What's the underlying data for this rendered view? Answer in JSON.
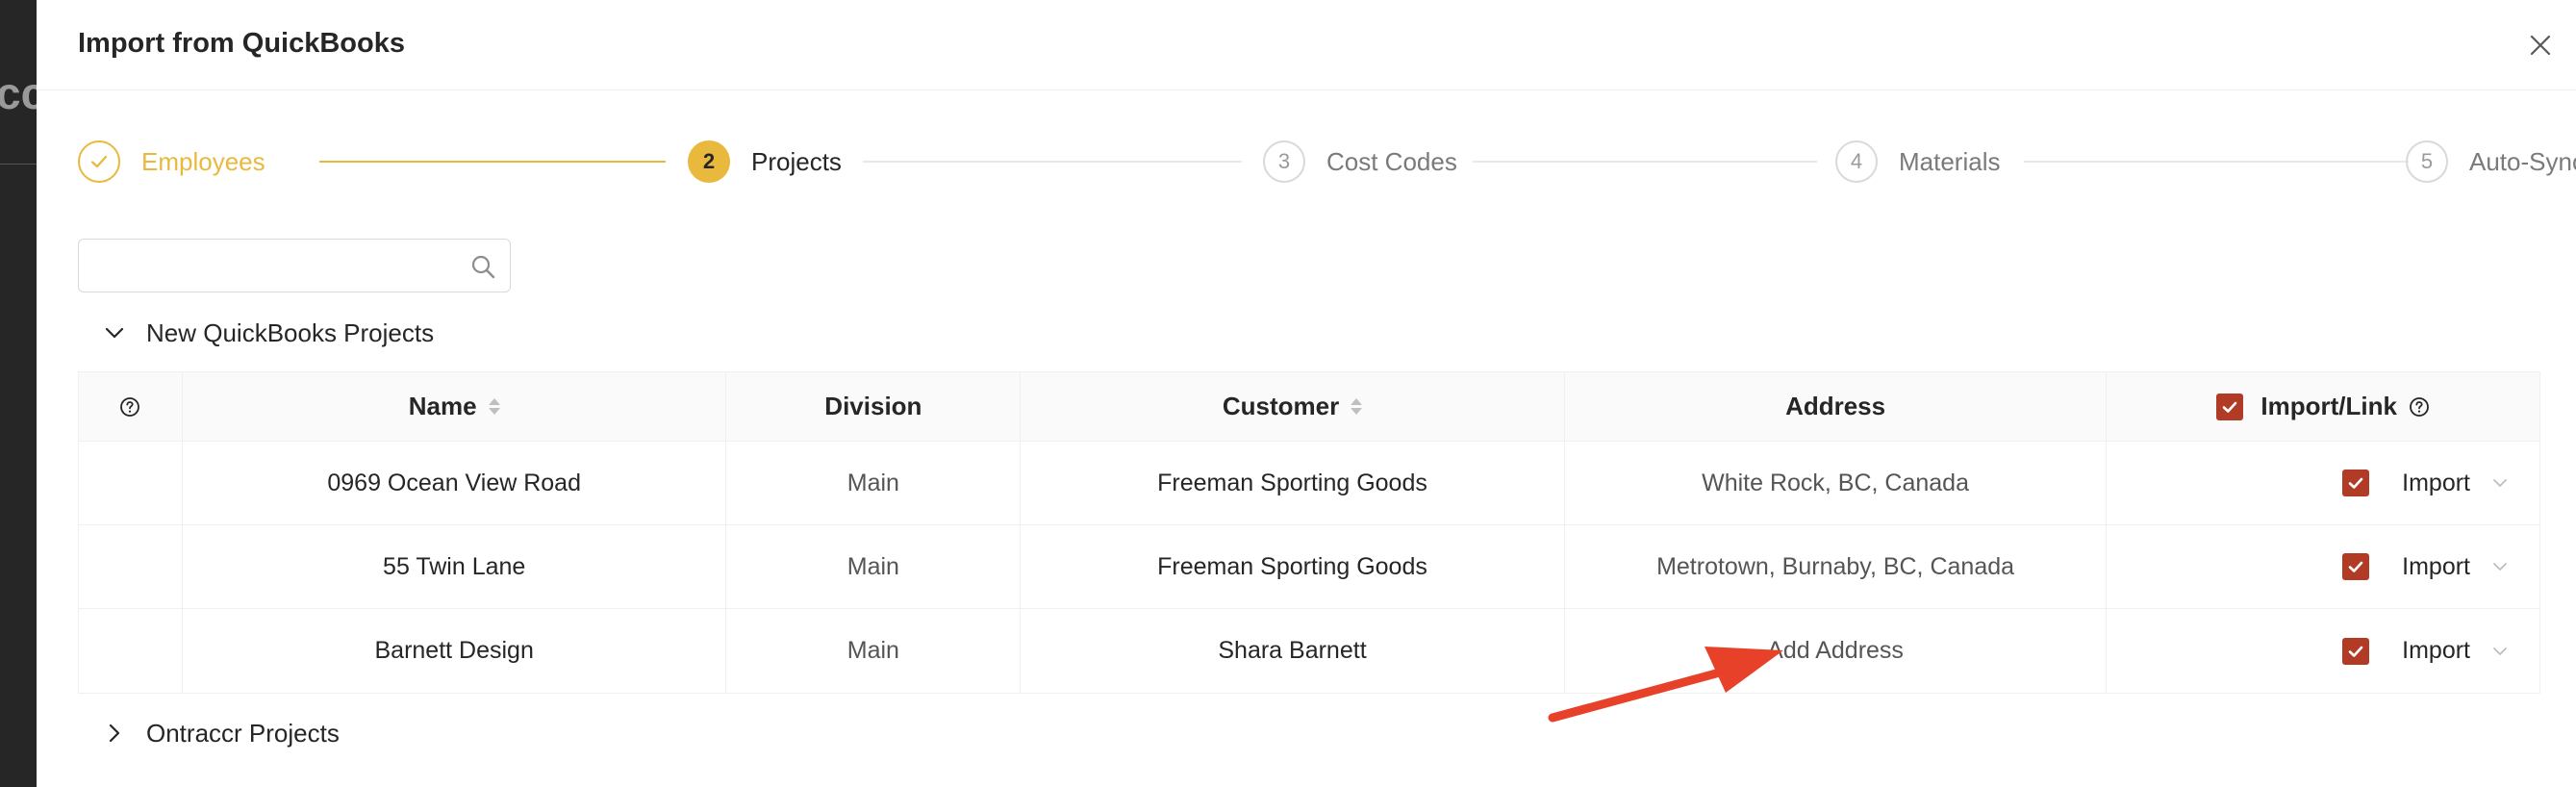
{
  "backdrop": {
    "logo_fragment": "cc"
  },
  "dialog": {
    "title": "Import from QuickBooks",
    "close_icon": "close-icon"
  },
  "steps": [
    {
      "number": "1",
      "label": "Employees",
      "status": "done"
    },
    {
      "number": "2",
      "label": "Projects",
      "status": "active"
    },
    {
      "number": "3",
      "label": "Cost Codes",
      "status": "wait"
    },
    {
      "number": "4",
      "label": "Materials",
      "status": "wait"
    },
    {
      "number": "5",
      "label": "Auto-Sync",
      "status": "wait"
    }
  ],
  "search": {
    "value": "",
    "placeholder": "",
    "icon": "search-icon"
  },
  "sections": {
    "new_qb": {
      "label": "New QuickBooks Projects",
      "expanded": true
    },
    "ontraccr": {
      "label": "Ontraccr Projects",
      "expanded": false
    }
  },
  "table": {
    "columns": {
      "name": "Name",
      "division": "Division",
      "customer": "Customer",
      "address": "Address",
      "import_link": "Import/Link"
    },
    "rows": [
      {
        "name": "0969 Ocean View Road",
        "division": "Main",
        "customer": "Freeman Sporting Goods",
        "address": "White Rock, BC, Canada",
        "action": "Import"
      },
      {
        "name": "55 Twin Lane",
        "division": "Main",
        "customer": "Freeman Sporting Goods",
        "address": "Metrotown, Burnaby, BC, Canada",
        "action": "Import"
      },
      {
        "name": "Barnett Design",
        "division": "Main",
        "customer": "Shara Barnett",
        "address": "Add Address",
        "action": "Import"
      }
    ]
  },
  "colors": {
    "accent": "#e8b93d",
    "checkbox": "#b23b26",
    "annotation_arrow": "#e8412a",
    "backdrop": "#262626"
  }
}
